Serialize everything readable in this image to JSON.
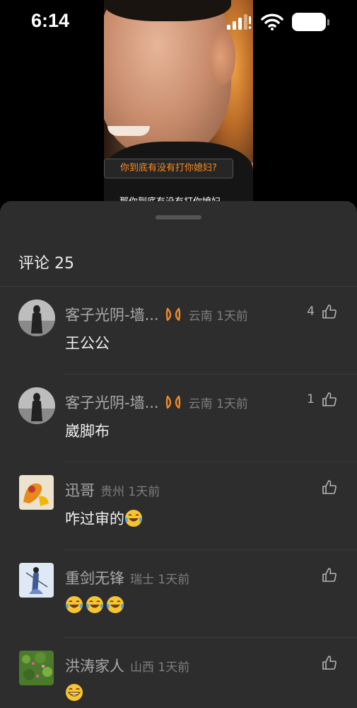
{
  "status_bar": {
    "time": "6:14"
  },
  "video": {
    "subtitle_top": "你到底有没有打你媳妇?",
    "subtitle_bottom": "那你到底有没有打你媳妇"
  },
  "comments_panel": {
    "title": "评论 25",
    "comments": [
      {
        "name": "客子光阴-墙...",
        "location_time": "云南 1天前",
        "text": "王公公",
        "likes": "4",
        "has_badge": true,
        "avatar": "silhouette-woman"
      },
      {
        "name": "客子光阴-墙...",
        "location_time": "云南 1天前",
        "text": "崴脚布",
        "likes": "1",
        "has_badge": true,
        "avatar": "silhouette-woman"
      },
      {
        "name": "迅哥",
        "location_time": "贵州 1天前",
        "text": "咋过审的",
        "likes": "",
        "has_badge": false,
        "avatar": "orange-art",
        "emoji": [
          "laughing-crying"
        ]
      },
      {
        "name": "重剑无锋",
        "location_time": "瑞士 1天前",
        "text": "",
        "likes": "",
        "has_badge": false,
        "avatar": "swordsman",
        "emoji": [
          "laughing-crying",
          "laughing-crying",
          "laughing-crying"
        ]
      },
      {
        "name": "洪涛家人",
        "location_time": "山西 1天前",
        "text": "",
        "likes": "",
        "has_badge": false,
        "avatar": "flowers",
        "emoji": [
          "grinning"
        ]
      }
    ]
  },
  "colors": {
    "sheet_bg": "#2d2d2d",
    "badge": "#f08a2a",
    "subtitle": "#ff8a1e"
  },
  "icons": {
    "like": "thumbs-up-icon",
    "badge": "infinity-badge-icon",
    "signal": "signal-icon",
    "wifi": "wifi-icon",
    "battery": "battery-icon"
  }
}
